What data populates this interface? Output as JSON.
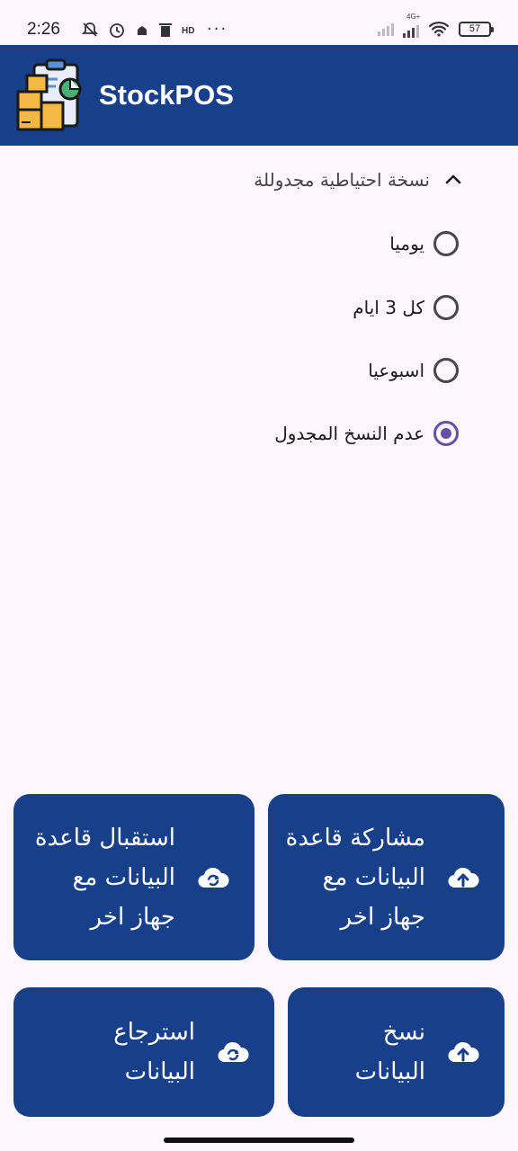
{
  "status_bar": {
    "time": "2:26",
    "network": "4G+",
    "battery": "57",
    "more": "···"
  },
  "app_bar": {
    "title": "StockPOS"
  },
  "scheduled_backup": {
    "title": "نسخة احتياطية مجدوللة",
    "expanded": true,
    "options": [
      {
        "label": "يوميا",
        "selected": false
      },
      {
        "label": "كل 3 ايام",
        "selected": false
      },
      {
        "label": "اسبوعيا",
        "selected": false
      },
      {
        "label": "عدم النسخ المجدول",
        "selected": true
      }
    ]
  },
  "actions": {
    "share_db": {
      "line1": "مشاركة قاعدة",
      "line2": "البيانات مع",
      "line3": "جهاز اخر",
      "icon": "cloud-upload-icon"
    },
    "receive_db": {
      "line1": "استقبال قاعدة",
      "line2": "البيانات مع",
      "line3": "جهاز اخر",
      "icon": "cloud-sync-icon"
    },
    "backup": {
      "line1": "نسخ",
      "line2": "البيانات",
      "icon": "cloud-upload-icon"
    },
    "restore": {
      "line1": "استرجاع",
      "line2": "البيانات",
      "icon": "cloud-sync-icon"
    }
  },
  "colors": {
    "primary": "#173f8a",
    "radio_selected": "#6750a4",
    "background": "#fdf6fd"
  }
}
